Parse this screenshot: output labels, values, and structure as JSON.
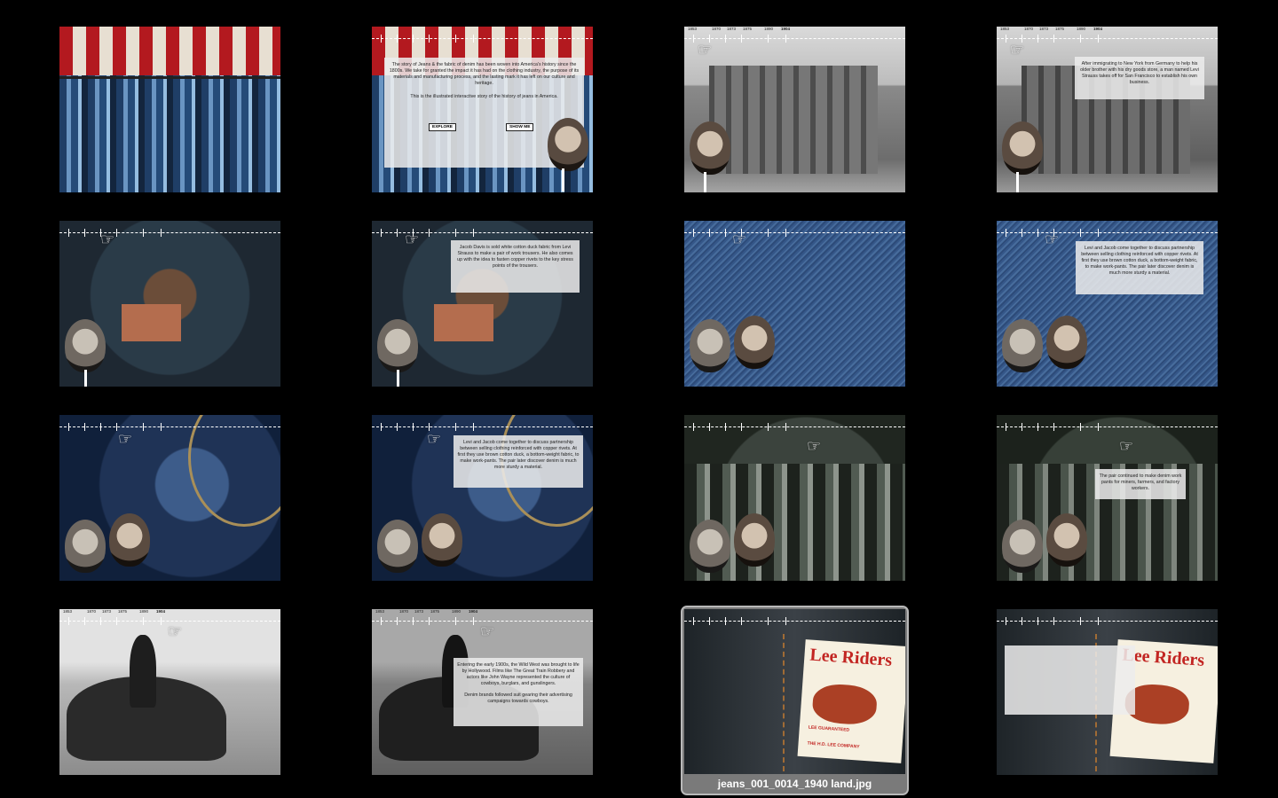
{
  "thumbnail_grid": {
    "selected_filename": "jeans_001_0014_1940 land.jpg",
    "thumbnails": [
      {
        "id": "t1",
        "scene": "clothing-rack"
      },
      {
        "id": "t2",
        "scene": "intro-overlay"
      },
      {
        "id": "t3",
        "scene": "building-grayscale"
      },
      {
        "id": "t4",
        "scene": "building-grayscale-text"
      },
      {
        "id": "t5",
        "scene": "worn-denim"
      },
      {
        "id": "t6",
        "scene": "worn-denim-text"
      },
      {
        "id": "t7",
        "scene": "denim-texture"
      },
      {
        "id": "t8",
        "scene": "denim-texture-text"
      },
      {
        "id": "t9",
        "scene": "denim-seam"
      },
      {
        "id": "t10",
        "scene": "denim-seam-text"
      },
      {
        "id": "t11",
        "scene": "workers-photo"
      },
      {
        "id": "t12",
        "scene": "workers-photo-text"
      },
      {
        "id": "t13",
        "scene": "cowboy-horse"
      },
      {
        "id": "t14",
        "scene": "cowboy-horse-text"
      },
      {
        "id": "t15",
        "scene": "lee-riders"
      },
      {
        "id": "t16",
        "scene": "lee-riders-blank"
      }
    ]
  },
  "timeline_years": [
    "1853",
    "1870",
    "1873",
    "1875",
    "1890",
    "1904"
  ],
  "intro_overlay": {
    "paragraph_1": "The story of Jeans & the fabric of denim has been woven into America's history since the 1800s. We take for granted the impact it has had on the clothing industry, the purpose of its materials and manufacturing process, and the lasting mark it has left on our culture and heritage.",
    "paragraph_2": "This is the illustrated interactive story of the history of jeans in America.",
    "explore_label": "EXPLORE",
    "show_me_label": "SHOW ME"
  },
  "slide_texts": {
    "levi_arrival": "After immigrating to New York from Germany to help his older brother with his dry goods store, a man named Levi Strauss takes off for San Francisco to establish his own business.",
    "jacob_davis": "Jacob Davis is sold white cotton duck fabric from Levi Strauss to make a pair of work trousers. He also comes up with the idea to fasten copper rivets to the key stress points of the trousers.",
    "partnership_1": "Levi and Jacob come together to discuss partnership between selling clothing reinforced with copper rivets. At first they use brown cotton duck, a bottom-weight fabric, to make work-pants. The pair later discover denim is much more sturdy a material.",
    "partnership_2": "Levi and Jacob come together to discuss partnership between selling clothing reinforced with copper rivets. At first they use brown cotton duck, a bottom-weight fabric, to make work-pants. The pair later discover denim is much more sturdy a material.",
    "work_pants": "The pair continued to make denim work pants for miners, farmers, and factory workers.",
    "wild_west": "Entering the early 1900s, the Wild West was brought to life by Hollywood. Films like The Great Train Robbery and actors like John Wayne represented the culture of cowboys, burglars, and gunslingers.",
    "wild_west_2": "Denim brands followed suit gearing their advertising campaigns towards cowboys."
  },
  "lee_label": {
    "brand": "Lee Riders",
    "line_1": "LEE GUARANTEED",
    "line_2": "THE H.D. LEE COMPANY"
  },
  "icons": {
    "pointer": "pointing-hand-icon",
    "portrait_levi": "levi-portrait-icon",
    "portrait_jacob": "jacob-portrait-icon"
  },
  "colors": {
    "background": "#000000",
    "selection_fill": "#7a7a7a",
    "selection_border": "#b9b9b9",
    "overlay": "#ececec"
  }
}
